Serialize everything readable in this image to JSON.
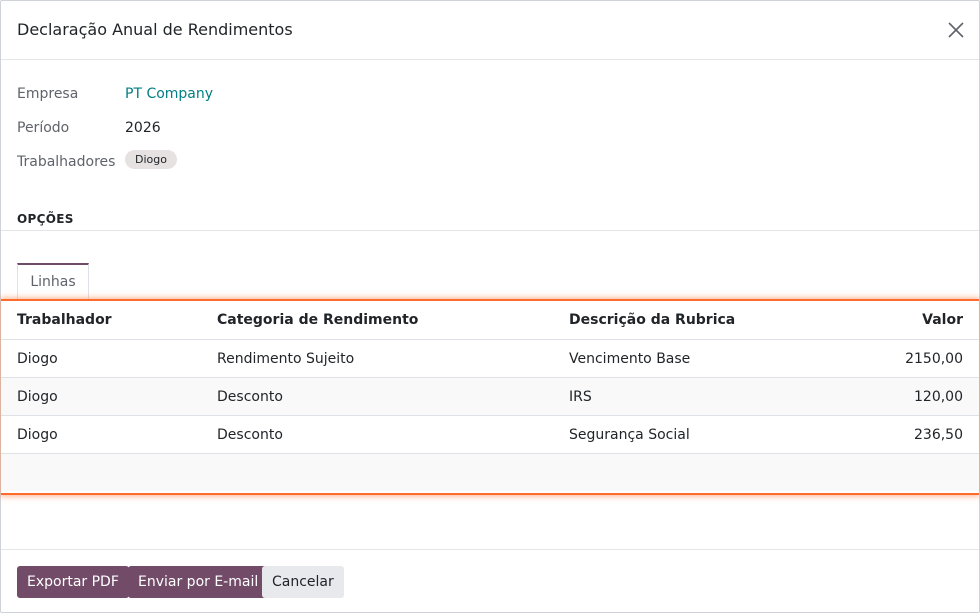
{
  "dialog": {
    "title": "Declaração Anual de Rendimentos",
    "close_icon": "close-icon"
  },
  "fields": {
    "empresa_label": "Empresa",
    "empresa_value": "PT Company",
    "periodo_label": "Período",
    "periodo_value": "2026",
    "trabalhadores_label": "Trabalhadores",
    "trabalhadores_tag": "Diogo"
  },
  "section": {
    "title": "OPÇÕES"
  },
  "tabs": [
    {
      "label": "Linhas",
      "active": true
    }
  ],
  "table": {
    "columns": [
      "Trabalhador",
      "Categoria de Rendimento",
      "Descrição da Rubrica",
      "Valor"
    ],
    "rows": [
      {
        "worker": "Diogo",
        "category": "Rendimento Sujeito",
        "description": "Vencimento Base",
        "value": "2150,00"
      },
      {
        "worker": "Diogo",
        "category": "Desconto",
        "description": "IRS",
        "value": "120,00"
      },
      {
        "worker": "Diogo",
        "category": "Desconto",
        "description": "Segurança Social",
        "value": "236,50"
      }
    ]
  },
  "footer": {
    "export_label": "Exportar PDF",
    "email_label": "Enviar por E-mail",
    "cancel_label": "Cancelar"
  },
  "colors": {
    "primary": "#714b67",
    "link": "#017e84",
    "highlight": "#ff6b2c"
  }
}
